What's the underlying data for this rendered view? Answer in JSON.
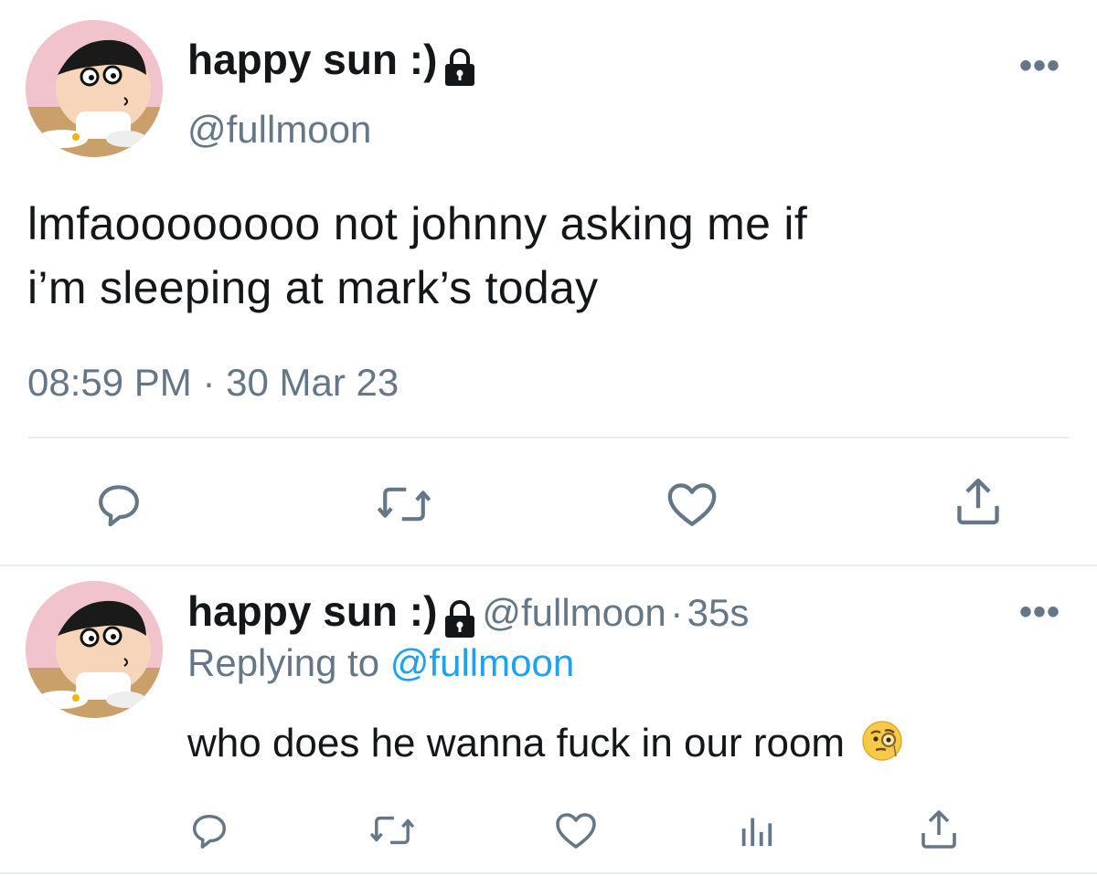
{
  "main_tweet": {
    "display_name": "happy sun :)",
    "handle": "@fullmoon",
    "text_line1": "lmfaoooooooo not johnny asking me if",
    "text_line2": "i’m sleeping at mark’s today",
    "time": "08:59 PM",
    "date": "30 Mar 23",
    "separator": "·",
    "more_label": "•••"
  },
  "reply_tweet": {
    "display_name": "happy sun :)",
    "handle": "@fullmoon",
    "separator": "·",
    "age": "35s",
    "replying_label": "Replying to",
    "replying_handle": "@fullmoon",
    "text": "who does he wanna fuck in our room",
    "emoji": "🧐",
    "more_label": "•••"
  },
  "icons": {
    "lock": "lock-icon",
    "reply": "reply-icon",
    "retweet": "retweet-icon",
    "like": "heart-icon",
    "share": "share-icon",
    "analytics": "analytics-icon"
  },
  "colors": {
    "text": "#14171a",
    "muted": "#657786",
    "link": "#1da1f2",
    "divider": "#e6ecf0"
  }
}
